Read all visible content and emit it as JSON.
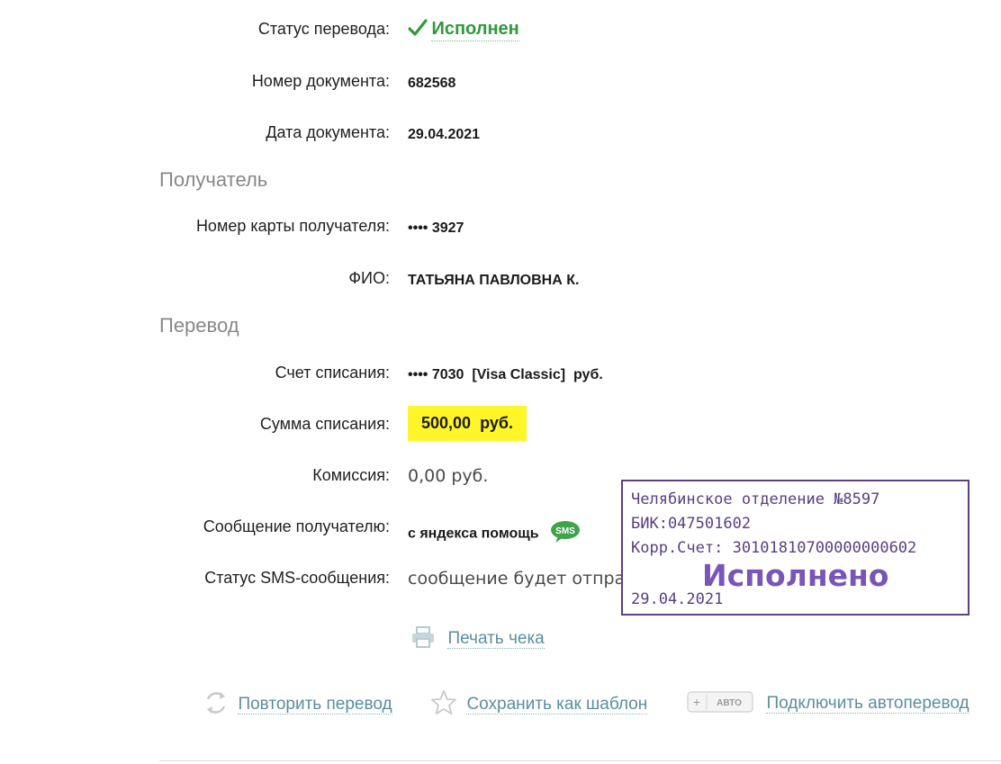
{
  "status": {
    "label": "Статус перевода:",
    "value": "Исполнен"
  },
  "document": {
    "number_label": "Номер документа:",
    "number": "682568",
    "date_label": "Дата документа:",
    "date": "29.04.2021"
  },
  "recipient": {
    "section_title": "Получатель",
    "card_label": "Номер карты получателя:",
    "card": "•••• 3927",
    "name_label": "ФИО:",
    "name": "ТАТЬЯНА ПАВЛОВНА К."
  },
  "transfer": {
    "section_title": "Перевод",
    "account_label": "Счет списания:",
    "account": "•••• 7030  [Visa Classic]  руб.",
    "amount_label": "Сумма списания:",
    "amount": "500,00  руб.",
    "commission_label": "Комиссия:",
    "commission": "0,00 руб.",
    "message_label": "Сообщение получателю:",
    "message": "с яндекса помощь",
    "sms_badge": "SMS",
    "sms_status_label": "Статус SMS-сообщения:",
    "sms_status": "сообщение будет отправлено"
  },
  "actions": {
    "print": "Печать чека",
    "repeat": "Повторить перевод",
    "save_template": "Сохранить как шаблон",
    "auto_badge_plus": "+",
    "auto_badge": "АВТО",
    "auto": "Подключить автоперевод"
  },
  "stamp": {
    "branch": "Челябинское отделение №8597",
    "bik": "БИК:047501602",
    "corr": "Корр.Счет: 30101810700000000602",
    "done": "Исполнено",
    "date": "29.04.2021"
  },
  "colors": {
    "success": "#2e9a3a",
    "highlight": "#fff62a",
    "link": "#5a8ea0",
    "stamp": "#5b4182"
  },
  "icons": [
    "check-icon",
    "sms-icon",
    "printer-icon",
    "repeat-icon",
    "star-icon",
    "auto-icon"
  ]
}
